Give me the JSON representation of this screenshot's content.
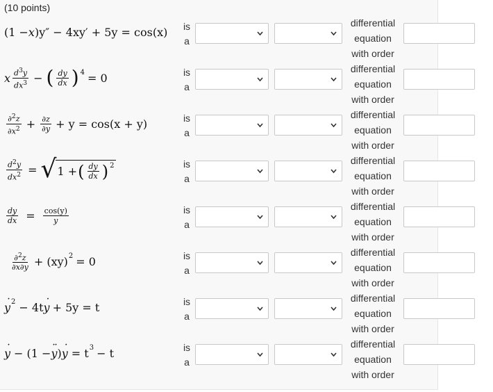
{
  "header": {
    "points": "(10 points)"
  },
  "labels": {
    "is": "is",
    "a": "a",
    "differential": "differential",
    "equation": "equation",
    "with_order": "with order"
  },
  "rows": [
    {
      "id": 1,
      "select1": "",
      "select2": "",
      "order": ""
    },
    {
      "id": 2,
      "select1": "",
      "select2": "",
      "order": ""
    },
    {
      "id": 3,
      "select1": "",
      "select2": "",
      "order": ""
    },
    {
      "id": 4,
      "select1": "",
      "select2": "",
      "order": ""
    },
    {
      "id": 5,
      "select1": "",
      "select2": "",
      "order": ""
    },
    {
      "id": 6,
      "select1": "",
      "select2": "",
      "order": ""
    },
    {
      "id": 7,
      "select1": "",
      "select2": "",
      "order": ""
    },
    {
      "id": 8,
      "select1": "",
      "select2": "",
      "order": ""
    }
  ],
  "equations": {
    "e1": {
      "lead": "(1 − ",
      "rest": ")y″ − 4xy′ + 5y = cos(x)"
    },
    "e2": {
      "x": "x",
      "minus": "−",
      "exp": "4",
      "rhs": "= 0"
    },
    "e3": {
      "plus": "+",
      "rest": "+ y = cos(x + y)"
    },
    "e4": {
      "eq": "=",
      "one": "1 +",
      "exp": "2"
    },
    "e5": {
      "eq": "=",
      "num": "cos(y)",
      "den": "y"
    },
    "e6": {
      "rest": "+ (xy)",
      "exp": "2",
      "rhs": "= 0"
    },
    "e7": {
      "y": "y",
      "exp": "2",
      "rest": "− 4t",
      "rest2": "+ 5y = t"
    },
    "e8": {
      "a": "y",
      "b": "− (1 − ",
      "c": "y",
      "d": ") ",
      "e": "y",
      "f": "= t",
      "exp": "3",
      "g": "− t"
    }
  },
  "colors": {
    "panel": "#f8f8f8",
    "border": "#c8c8c8",
    "chevron": "#333333"
  }
}
